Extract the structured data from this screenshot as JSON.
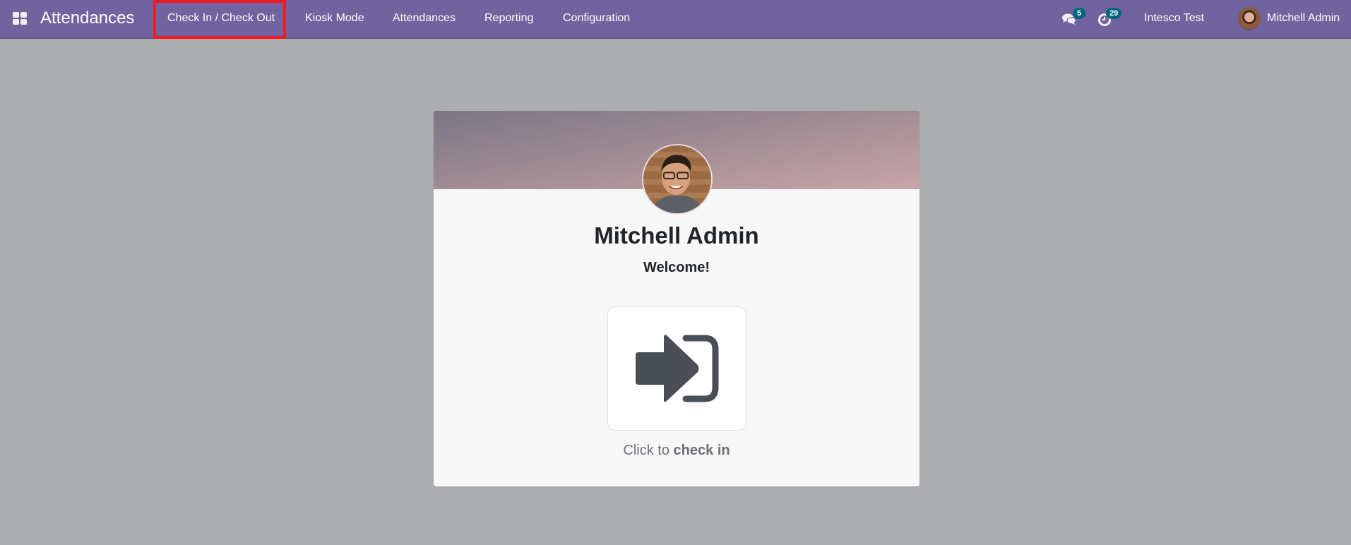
{
  "navbar": {
    "app_menu_icon": "app-grid-icon",
    "brand": "Attendances",
    "menu_items": [
      {
        "label": "Check In / Check Out",
        "active": true
      },
      {
        "label": "Kiosk Mode"
      },
      {
        "label": "Attendances"
      },
      {
        "label": "Reporting"
      },
      {
        "label": "Configuration"
      }
    ],
    "highlight_color": "#ec1c24",
    "messages": {
      "icon": "chat-icon",
      "count": "5"
    },
    "activities": {
      "icon": "clock-icon",
      "count": "29"
    },
    "company": "Intesco Test",
    "user": {
      "name": "Mitchell Admin",
      "avatar": "user-avatar"
    }
  },
  "card": {
    "employee_name": "Mitchell Admin",
    "greeting": "Welcome!",
    "action_icon": "sign-in-icon",
    "action_prefix": "Click to",
    "action_verb": "check in"
  },
  "colors": {
    "navbar": "#71639e",
    "background": "#acadaf",
    "badge": "#01657f",
    "icon": "#4a4f57"
  }
}
